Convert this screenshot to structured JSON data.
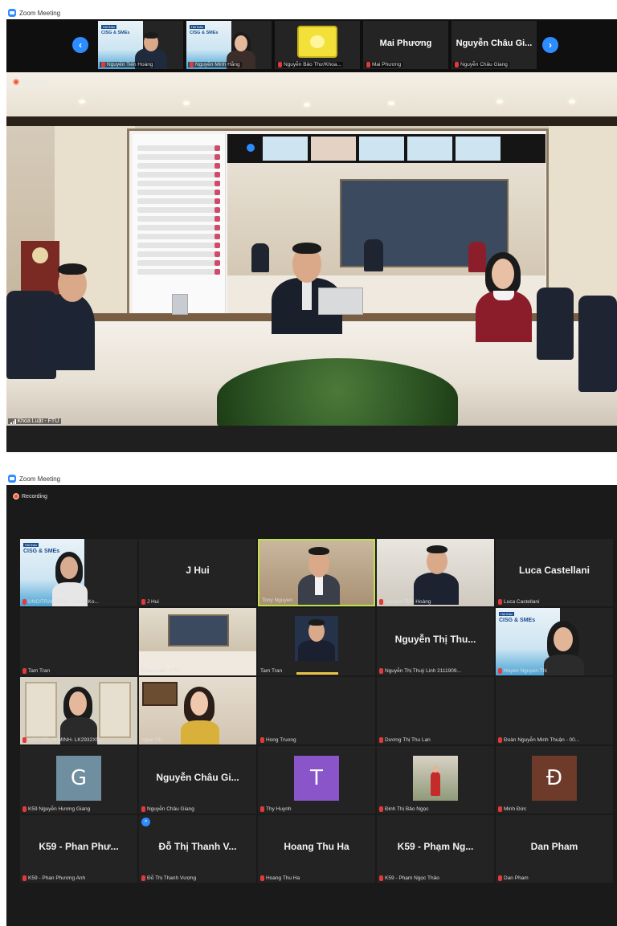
{
  "window1": {
    "title": "Zoom Meeting",
    "recording": "Recording",
    "strip": {
      "prev_icon": "chevron-left-icon",
      "next_icon": "chevron-right-icon",
      "participants": [
        {
          "name": "Nguyễn Tiến Hoàng",
          "banner": "CISG & SMEs",
          "banner_tag": "Hội thảo"
        },
        {
          "name": "Nguyễn Minh Hằng",
          "banner": "CISG & SMEs",
          "banner_tag": "Hội thảo"
        },
        {
          "name": "Nguyễn Bảo Thư/Khoa..."
        },
        {
          "name": "Mai Phương",
          "display": "Mai Phương"
        },
        {
          "name": "Nguyễn Châu Giang",
          "display": "Nguyễn Châu Gi..."
        }
      ]
    },
    "main_label": "Khoa Luật - FTU"
  },
  "window2": {
    "title": "Zoom Meeting",
    "recording": "Recording",
    "tiles": [
      {
        "name": "UNCITRAL RCAP_Athira Ko...",
        "banner": "CISG & SMEs",
        "banner_tag": "Hội thảo"
      },
      {
        "name": "J Hui",
        "display": "J Hui"
      },
      {
        "name": "Tony Nguyen"
      },
      {
        "name": "Nguyễn Tiến Hoàng"
      },
      {
        "name": "Luca Castellani",
        "display": "Luca Castellani"
      },
      {
        "name": "Tam Tran"
      },
      {
        "name": "Khoa Luật - FTU"
      },
      {
        "name": "Tam Tran"
      },
      {
        "name": "Nguyễn Thị Thuỳ Linh 2111909...",
        "display": "Nguyễn Thị Thu..."
      },
      {
        "name": "Huyen Nguyen Thi",
        "banner": "CISG & SMEs",
        "banner_tag": "Hội thảo"
      },
      {
        "name": "NGUYEN AI MINH- LK2932X5..."
      },
      {
        "name": "Ngan VU"
      },
      {
        "name": "Hong Truong"
      },
      {
        "name": "Dương Thị Thu Lan"
      },
      {
        "name": "Đoàn Nguyễn Minh Thuận - 00..."
      },
      {
        "name": "K59 Nguyễn Hương Giang",
        "avatar": "G"
      },
      {
        "name": "Nguyễn Châu Giang",
        "display": "Nguyễn Châu Gi..."
      },
      {
        "name": "Thy Huynh",
        "avatar": "T"
      },
      {
        "name": "Đinh Thị Bảo Ngọc"
      },
      {
        "name": "Minh Đức",
        "avatar": "Đ"
      },
      {
        "name": "K59 - Phan Phương Anh",
        "display": "K59 - Phan Phư..."
      },
      {
        "name": "Đỗ Thị Thanh Vượng",
        "display": "Đỗ Thị Thanh V..."
      },
      {
        "name": "Hoang Thu Ha",
        "display": "Hoang Thu Ha"
      },
      {
        "name": "K59 - Phạm Ngọc Thảo",
        "display": "K59 - Phạm Ng..."
      },
      {
        "name": "Dan Pham",
        "display": "Dan Pham"
      }
    ]
  },
  "colors": {
    "zoom_blue": "#2d8cff",
    "active_speaker": "#bfe04a",
    "muted_red": "#e23a3a",
    "avatar_g": "#6f8fa0",
    "avatar_t": "#8a55c9",
    "avatar_d": "#6e3a2a"
  }
}
